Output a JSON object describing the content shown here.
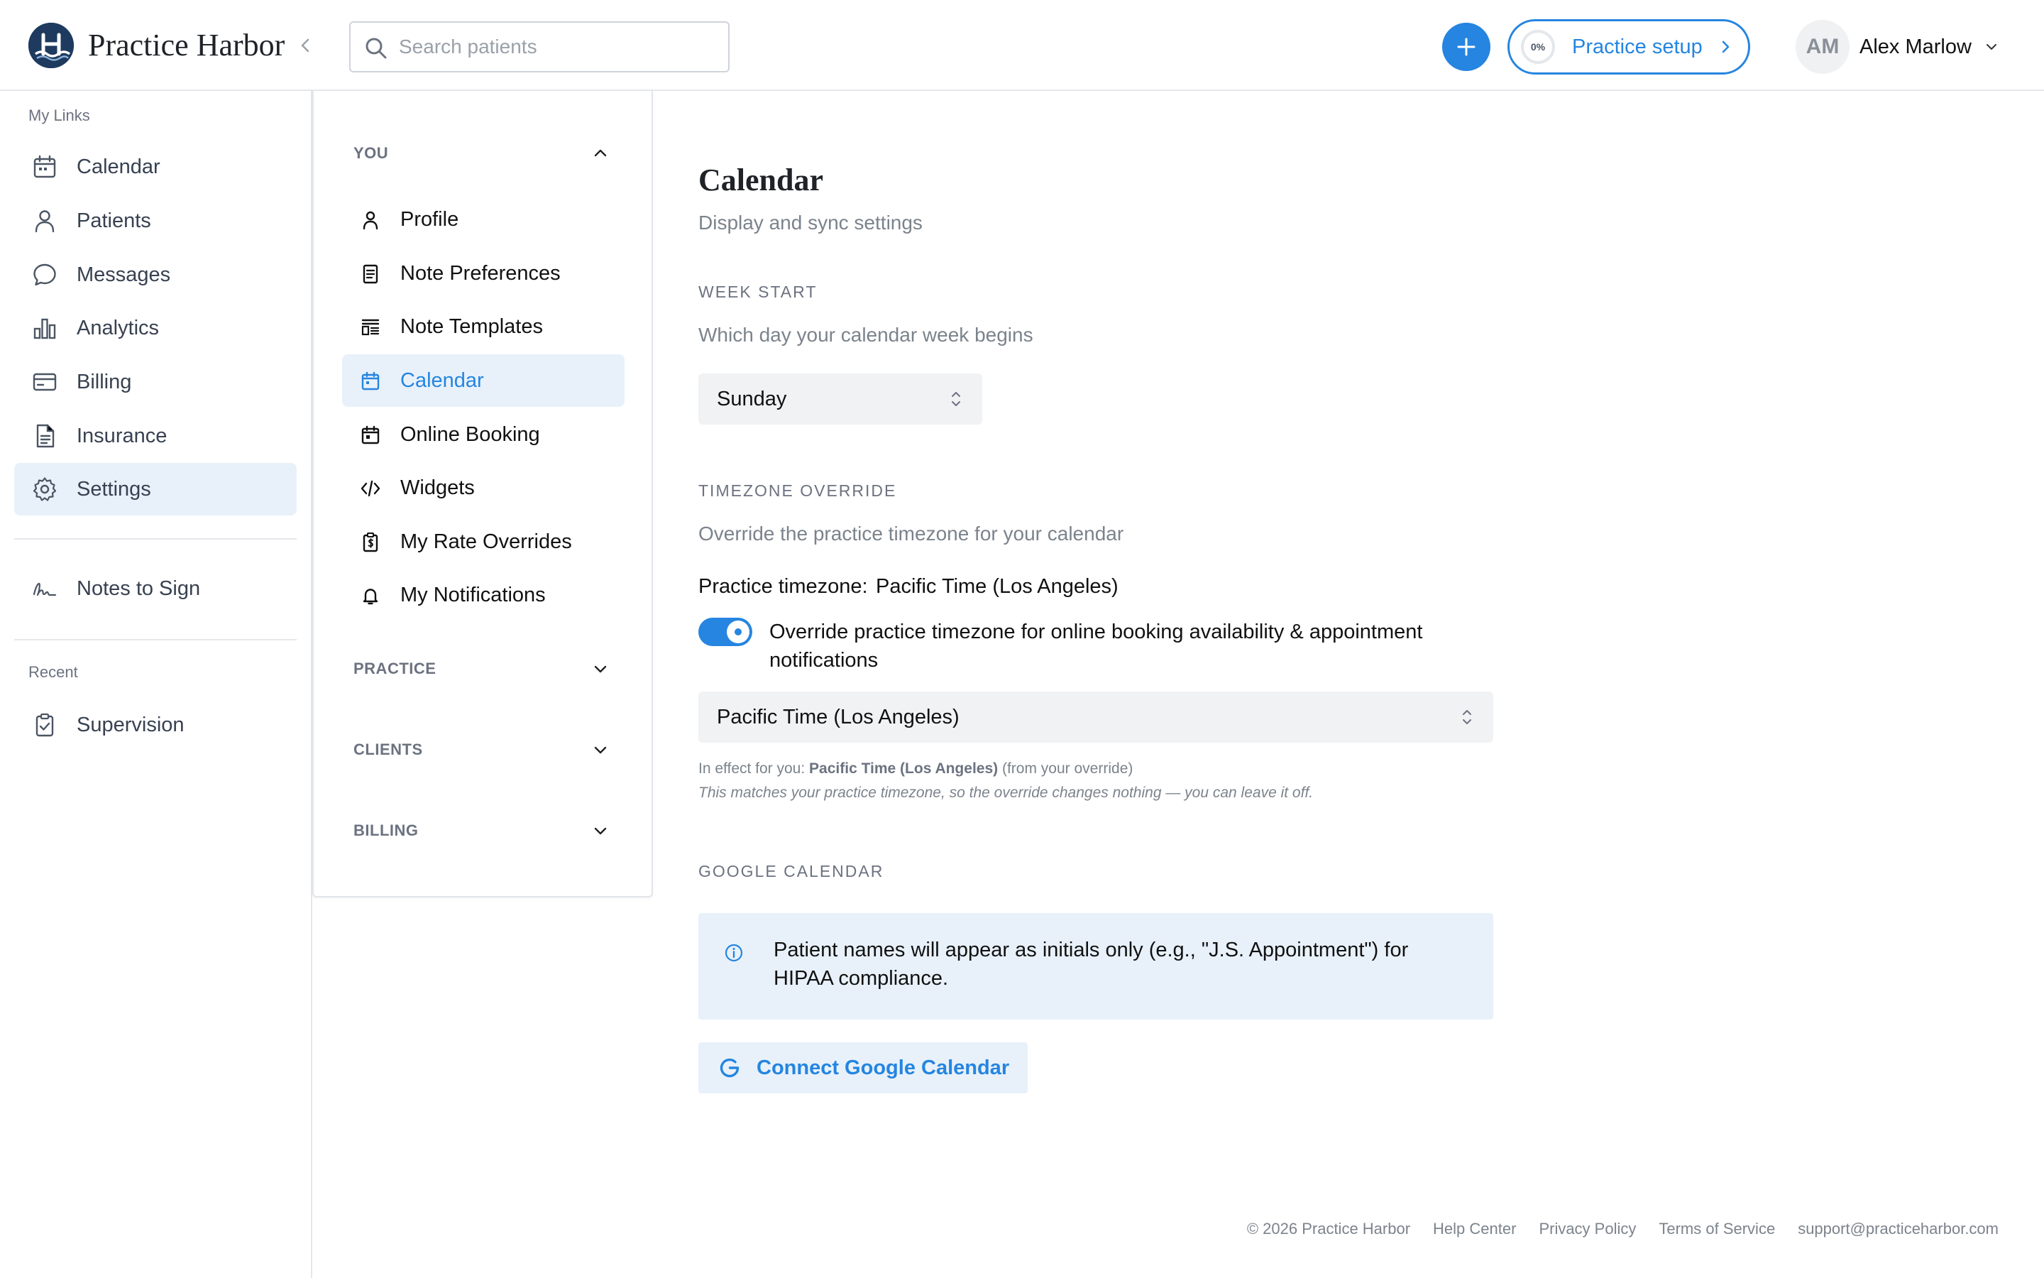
{
  "app": {
    "name": "Practice Harbor"
  },
  "header": {
    "search_placeholder": "Search patients",
    "setup": {
      "progress_label": "0%",
      "label": "Practice setup"
    },
    "user": {
      "initials": "AM",
      "name": "Alex Marlow"
    }
  },
  "sidebar": {
    "my_links_heading": "My Links",
    "items": [
      {
        "label": "Calendar",
        "icon": "calendar-icon"
      },
      {
        "label": "Patients",
        "icon": "user-icon"
      },
      {
        "label": "Messages",
        "icon": "message-icon"
      },
      {
        "label": "Analytics",
        "icon": "bar-chart-icon"
      },
      {
        "label": "Billing",
        "icon": "credit-card-icon"
      },
      {
        "label": "Insurance",
        "icon": "document-icon"
      },
      {
        "label": "Settings",
        "icon": "gear-icon",
        "active": true
      }
    ],
    "notes_to_sign": "Notes to Sign",
    "recent_heading": "Recent",
    "recent": [
      {
        "label": "Supervision",
        "icon": "clipboard-icon"
      }
    ]
  },
  "settings_nav": {
    "you": {
      "title": "YOU",
      "expanded": true,
      "items": [
        {
          "label": "Profile",
          "icon": "user-icon"
        },
        {
          "label": "Note Preferences",
          "icon": "note-icon"
        },
        {
          "label": "Note Templates",
          "icon": "template-icon"
        },
        {
          "label": "Calendar",
          "icon": "calendar-icon",
          "active": true
        },
        {
          "label": "Online Booking",
          "icon": "calendar-check-icon"
        },
        {
          "label": "Widgets",
          "icon": "code-icon"
        },
        {
          "label": "My Rate Overrides",
          "icon": "clipboard-dollar-icon"
        },
        {
          "label": "My Notifications",
          "icon": "bell-icon"
        }
      ]
    },
    "practice": {
      "title": "PRACTICE",
      "expanded": false
    },
    "clients": {
      "title": "CLIENTS",
      "expanded": false
    },
    "billing": {
      "title": "BILLING",
      "expanded": false
    }
  },
  "main": {
    "title": "Calendar",
    "subtitle": "Display and sync settings",
    "week_start": {
      "heading": "WEEK START",
      "description": "Which day your calendar week begins",
      "value": "Sunday"
    },
    "timezone": {
      "heading": "TIMEZONE OVERRIDE",
      "description": "Override the practice timezone for your calendar",
      "practice_label": "Practice timezone:",
      "practice_value": "Pacific Time (Los Angeles)",
      "override_enabled": true,
      "override_label": "Override practice timezone for online booking availability & appointment notifications",
      "override_value": "Pacific Time (Los Angeles)",
      "effect_prefix": "In effect for you:",
      "effect_value": "Pacific Time (Los Angeles)",
      "effect_suffix": "(from your override)",
      "note": "This matches your practice timezone, so the override changes nothing — you can leave it off."
    },
    "google": {
      "heading": "GOOGLE CALENDAR",
      "info": "Patient names will appear as initials only (e.g., \"J.S. Appointment\") for HIPAA compliance.",
      "connect_label": "Connect Google Calendar"
    }
  },
  "footer": {
    "copyright": "© 2026 Practice Harbor",
    "links": [
      "Help Center",
      "Privacy Policy",
      "Terms of Service",
      "support@practiceharbor.com"
    ]
  },
  "colors": {
    "accent": "#2585e0",
    "active_bg": "#e8f1fa",
    "brand_navy": "#1e3a5f"
  }
}
